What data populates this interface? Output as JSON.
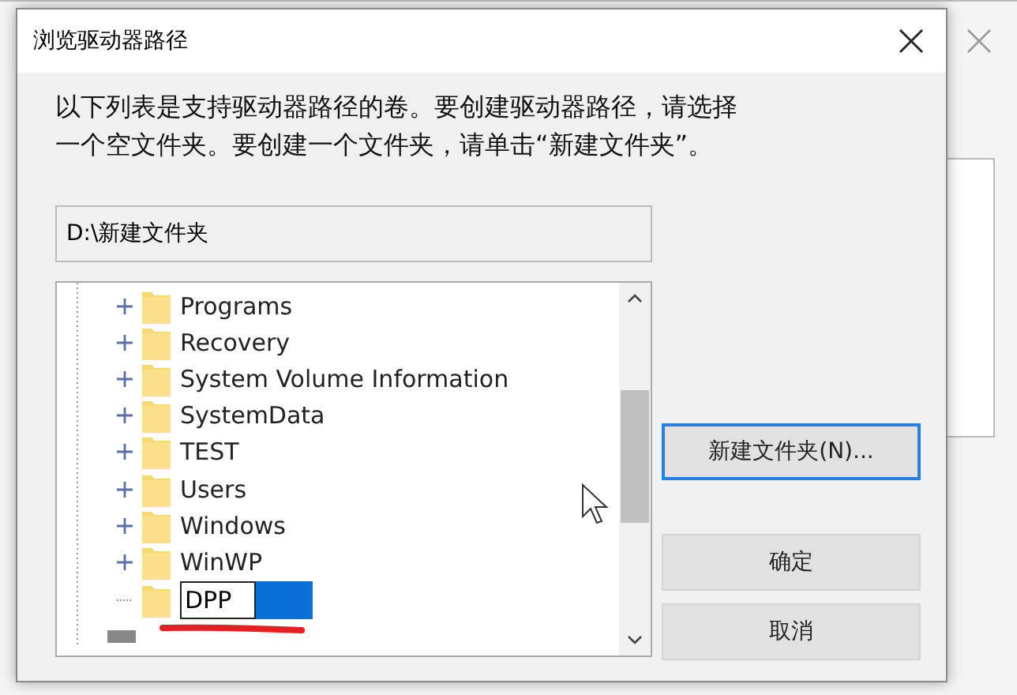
{
  "dialog": {
    "title": "浏览驱动器路径",
    "description": "以下列表是支持驱动器路径的卷。要创建驱动器路径，请选择一个空文件夹。要创建一个文件夹，请单击“新建文件夹”。",
    "path": "D:\\新建文件夹"
  },
  "tree": {
    "items": [
      {
        "label": "Programs",
        "expandable": true,
        "editing": false
      },
      {
        "label": "Recovery",
        "expandable": true,
        "editing": false
      },
      {
        "label": "System Volume Information",
        "expandable": true,
        "editing": false
      },
      {
        "label": "SystemData",
        "expandable": true,
        "editing": false
      },
      {
        "label": "TEST",
        "expandable": true,
        "editing": false
      },
      {
        "label": "Users",
        "expandable": true,
        "editing": false
      },
      {
        "label": "Windows",
        "expandable": true,
        "editing": false
      },
      {
        "label": "WinWP",
        "expandable": true,
        "editing": false
      },
      {
        "label": "DPP",
        "expandable": false,
        "editing": true
      }
    ]
  },
  "buttons": [
    {
      "label": "新建文件夹(N)...",
      "default": true
    },
    {
      "label": "确定",
      "default": false
    },
    {
      "label": "取消",
      "default": false
    }
  ]
}
